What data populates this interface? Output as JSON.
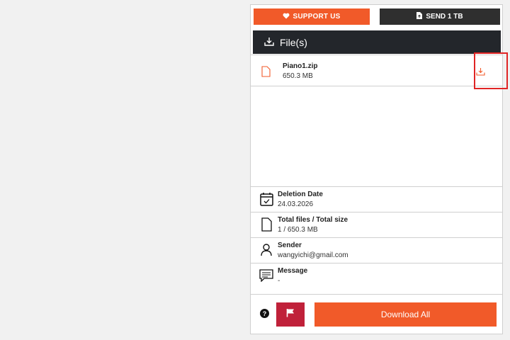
{
  "top": {
    "support_label": "SUPPORT US",
    "send_label": "SEND 1 TB"
  },
  "files": {
    "header": "File(s)",
    "items": [
      {
        "name": "Piano1.zip",
        "size": "650.3 MB"
      }
    ]
  },
  "info": {
    "deletion": {
      "label": "Deletion Date",
      "value": "24.03.2026"
    },
    "total": {
      "label": "Total files / Total size",
      "value": "1 / 650.3 MB"
    },
    "sender": {
      "label": "Sender",
      "value": "wangyichi@gmail.com"
    },
    "message": {
      "label": "Message",
      "value": "-"
    }
  },
  "bottom": {
    "help_glyph": "?",
    "download_all_label": "Download All"
  },
  "colors": {
    "accent": "#f15a29",
    "dark": "#23262b",
    "flag": "#c0213a",
    "highlight": "#e02424"
  }
}
